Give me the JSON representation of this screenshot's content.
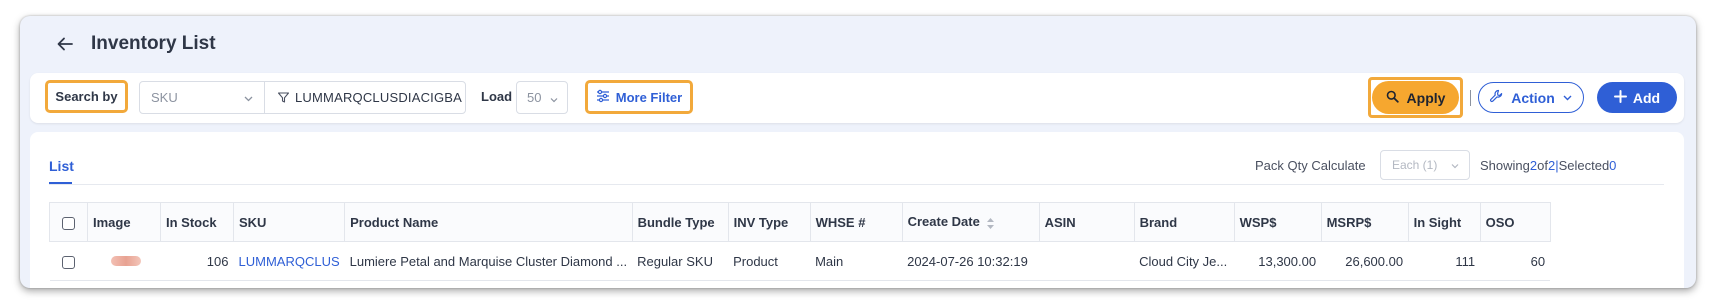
{
  "header": {
    "title": "Inventory List"
  },
  "toolbar": {
    "search_by_label": "Search by",
    "search_field_value": "SKU",
    "filter_value": "LUMMARQCLUSDIACIGBA",
    "load_label": "Load",
    "load_value": "50",
    "more_filter_label": "More Filter",
    "apply_label": "Apply",
    "action_label": "Action",
    "add_label": "Add"
  },
  "panel": {
    "tab_label": "List",
    "pack_qty_label": "Pack Qty Calculate",
    "pack_qty_value": "Each (1)",
    "showing_label": "Showing",
    "showing_count": "2",
    "of_label": "of",
    "total_count": "2",
    "pipe": "|",
    "selected_label": "Selected",
    "selected_count": "0"
  },
  "table": {
    "columns": [
      "Image",
      "In Stock",
      "SKU",
      "Product Name",
      "Bundle Type",
      "INV Type",
      "WHSE #",
      "Create Date",
      "ASIN",
      "Brand",
      "WSP$",
      "MSRP$",
      "In Sight",
      "OSO"
    ],
    "rows": [
      {
        "in_stock": "106",
        "sku": "LUMMARQCLUS",
        "product_name": "Lumiere Petal and Marquise Cluster Diamond ...",
        "bundle_type": "Regular SKU",
        "inv_type": "Product",
        "whse": "Main",
        "create_date": "2024-07-26 10:32:19",
        "asin": "",
        "brand": "Cloud City Je...",
        "wsp": "13,300.00",
        "msrp": "26,600.00",
        "in_sight": "111",
        "oso": "60"
      }
    ]
  },
  "colors": {
    "accent": "#2f5fd6",
    "apply": "#f6a72f",
    "highlight": "#f2a93b"
  }
}
